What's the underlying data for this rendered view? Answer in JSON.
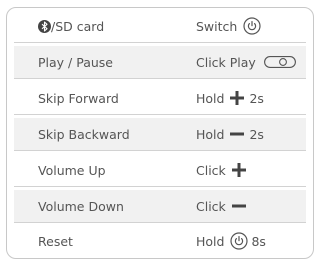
{
  "rows": [
    {
      "action": "/SD card",
      "method": "Switch",
      "icons": [
        "bluetooth-icon",
        "power-icon"
      ]
    },
    {
      "action": "Play / Pause",
      "method": "Click Play",
      "icons": [
        "toggle-switch-icon"
      ]
    },
    {
      "action": "Skip Forward",
      "method": "Hold",
      "detail": "2s",
      "icons": [
        "plus-icon"
      ]
    },
    {
      "action": "Skip Backward",
      "method": "Hold",
      "detail": "2s",
      "icons": [
        "minus-icon"
      ]
    },
    {
      "action": "Volume Up",
      "method": "Click",
      "icons": [
        "plus-icon"
      ]
    },
    {
      "action": "Volume Down",
      "method": "Click",
      "icons": [
        "minus-icon"
      ]
    },
    {
      "action": "Reset",
      "method": "Hold",
      "detail": "8s",
      "icons": [
        "power-icon"
      ]
    }
  ],
  "colors": {
    "text": "#555555",
    "border": "#c8c8c8",
    "shade": "#f1f1f1",
    "icon": "#444444"
  }
}
